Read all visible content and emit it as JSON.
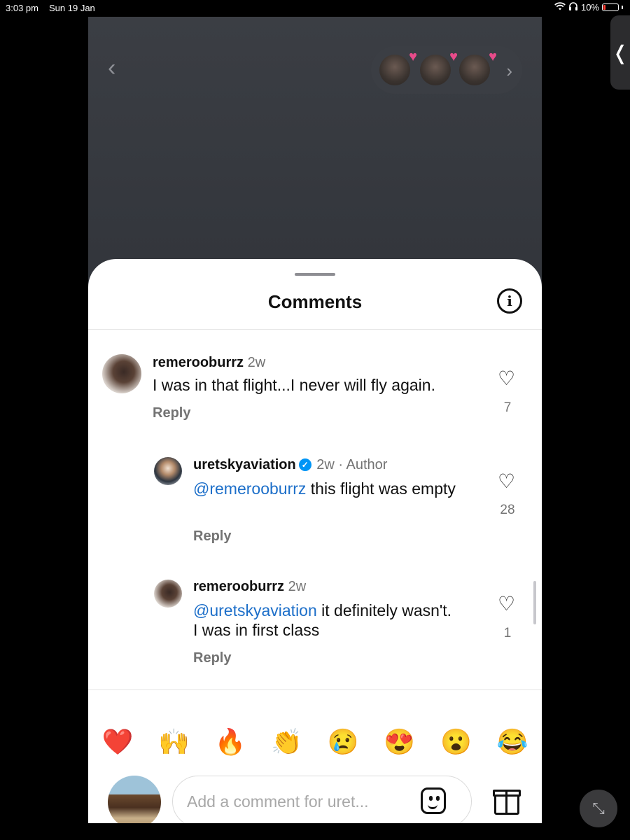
{
  "status_bar": {
    "time": "3:03 pm",
    "date": "Sun 19 Jan",
    "battery": "10%"
  },
  "sheet": {
    "title": "Comments"
  },
  "comments": [
    {
      "username": "remerooburrz",
      "meta": "2w",
      "text": "I was in that flight...I never will fly again.",
      "reply_label": "Reply",
      "likes": "7"
    },
    {
      "username": "uretskyaviation",
      "verified": true,
      "meta": "2w · Author",
      "mention": "@remerooburrz",
      "text": " this flight was empty",
      "reply_label": "Reply",
      "likes": "28"
    },
    {
      "username": "remerooburrz",
      "meta": "2w",
      "mention": "@uretskyaviation",
      "text": " it definitely wasn't. I was in first class",
      "reply_label": "Reply",
      "likes": "1"
    }
  ],
  "emoji_reactions": [
    "❤️",
    "🙌",
    "🔥",
    "👏",
    "😢",
    "😍",
    "😮",
    "😂"
  ],
  "composer": {
    "placeholder": "Add a comment for uret..."
  },
  "colors": {
    "mention": "#1d6fc9",
    "verified": "#0095f6",
    "battery_low": "#ff3b30"
  }
}
